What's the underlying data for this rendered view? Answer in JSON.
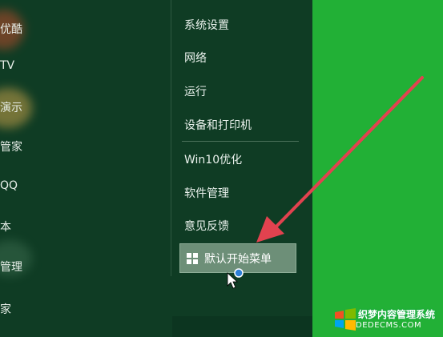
{
  "left_list": {
    "items": [
      {
        "label": "优酷"
      },
      {
        "label": "TV"
      },
      {
        "label": "演示"
      },
      {
        "label": "管家"
      },
      {
        "label": "QQ"
      },
      {
        "label": "本"
      },
      {
        "label": "管理"
      },
      {
        "label": "家"
      }
    ]
  },
  "menu": {
    "items": [
      {
        "label": "系统设置"
      },
      {
        "label": "网络"
      },
      {
        "label": "运行"
      },
      {
        "label": "设备和打印机"
      },
      {
        "label": "Win10优化"
      },
      {
        "label": "软件管理"
      },
      {
        "label": "意见反馈"
      }
    ],
    "highlight_label": "默认开始菜单"
  },
  "watermark": {
    "line1": "织梦内容管理系统",
    "line2": "DEDECMS.COM"
  },
  "colors": {
    "menu_bg": "#0f3c24",
    "desktop_green": "#22b036",
    "highlight": "#6d8f78",
    "arrow": "#e2424f"
  }
}
